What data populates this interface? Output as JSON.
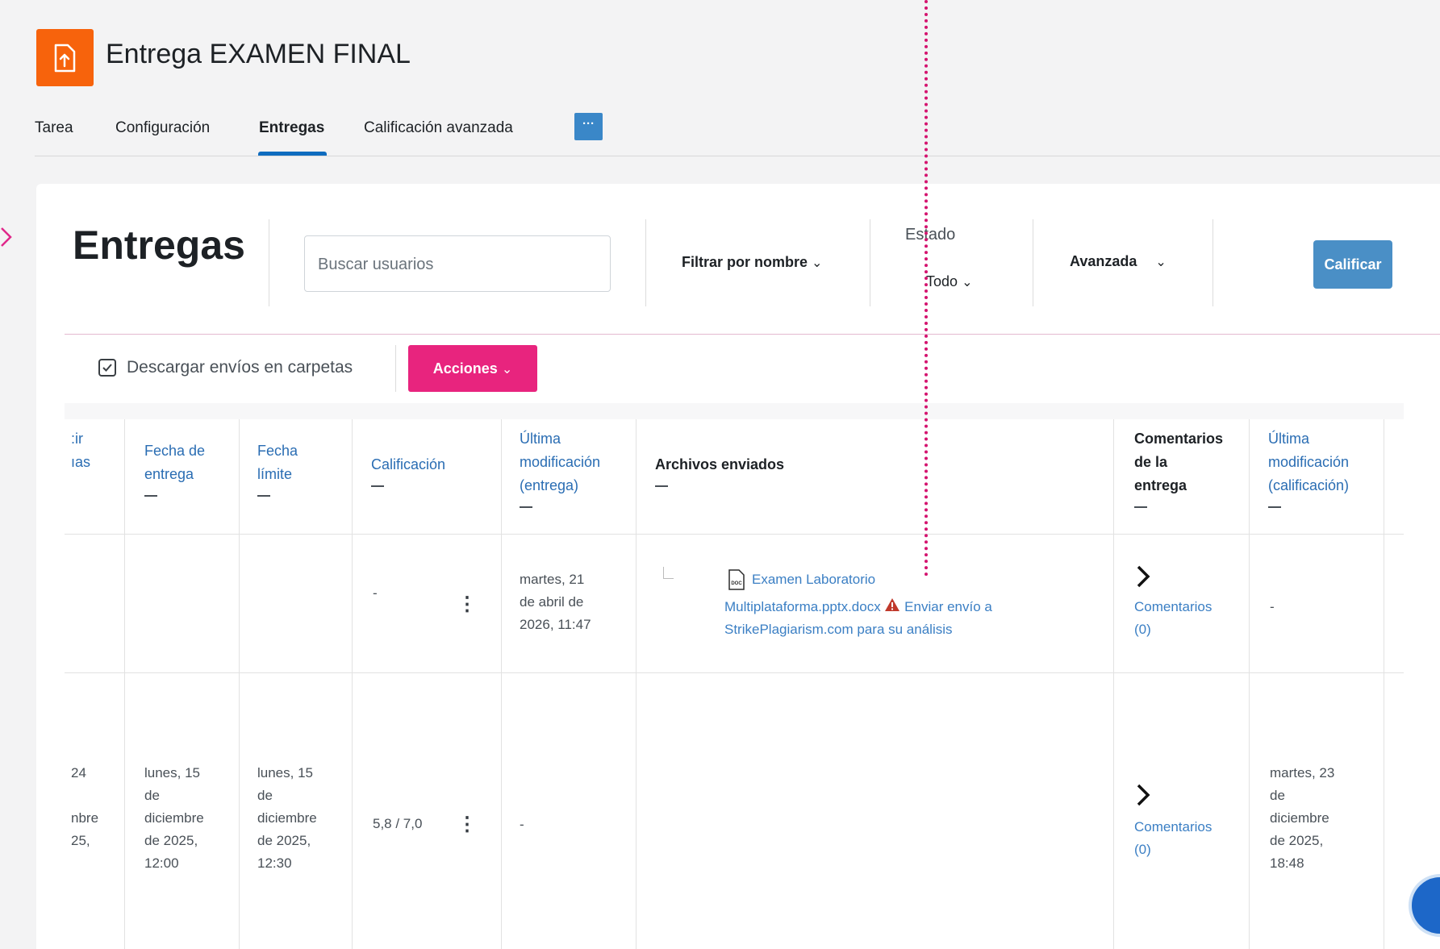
{
  "page": {
    "title": "Entrega EXAMEN FINAL",
    "tabs": [
      "Tarea",
      "Configuración",
      "Entregas",
      "Calificación avanzada"
    ],
    "more_label": "···"
  },
  "toolbar": {
    "heading": "Entregas",
    "search_placeholder": "Buscar usuarios",
    "filter_name": "Filtrar por nombre",
    "estado_label": "Estado",
    "estado_value": "Todo",
    "avanzada": "Avanzada",
    "calificar": "Calificar",
    "chevron": "⌄"
  },
  "actions": {
    "descargar": "Descargar envíos en carpetas",
    "acciones": "Acciones"
  },
  "table": {
    "headers": {
      "col0_l1": ":ir",
      "col0_l2": "ıas",
      "fecha_entrega": [
        "Fecha de",
        "entrega"
      ],
      "fecha_limite": [
        "Fecha",
        "límite"
      ],
      "calificacion": [
        "Calificación"
      ],
      "ultima_mod_entrega": [
        "Última",
        "modificación",
        "(entrega)"
      ],
      "archivos": [
        "Archivos enviados"
      ],
      "comentarios": [
        "Comentarios",
        "de la",
        "entrega"
      ],
      "ultima_mod_calif": [
        "Última",
        "modificación",
        "(calificación)"
      ]
    },
    "row1": {
      "calificacion": "-",
      "ultima_mod": [
        "martes, 21",
        "de abril de",
        "2026, 11:47"
      ],
      "file_name_1": "Examen Laboratorio",
      "file_name_2": "Multiplataforma.pptx.docx",
      "send_1": "Enviar envío a",
      "send_2": "StrikePlagiarism.com para su análisis",
      "comentarios": [
        "Comentarios",
        "(0)"
      ],
      "ultima_calif": "-"
    },
    "row2": {
      "col0": [
        "24",
        "",
        "nbre",
        "25,"
      ],
      "fecha_entrega": [
        "lunes, 15",
        "de",
        "diciembre",
        "de 2025,",
        "12:00"
      ],
      "fecha_limite": [
        "lunes, 15",
        "de",
        "diciembre",
        "de 2025,",
        "12:30"
      ],
      "calificacion": "5,8 / 7,0",
      "ultima_mod": "-",
      "comentarios": [
        "Comentarios",
        "(0)"
      ],
      "ultima_calif": [
        "martes, 23",
        "de",
        "diciembre",
        "de 2025,",
        "18:48"
      ]
    }
  },
  "colors": {
    "accent_orange": "#f7630c",
    "accent_pink": "#e8247e",
    "button_blue": "#4a8fc6",
    "link_blue": "#3b7fc4",
    "annotation_pink": "#d4146f"
  },
  "icons": {
    "assignment": "upload-file-icon",
    "doc": "docx-file-icon",
    "warning": "warning-triangle-icon",
    "expand": "chevron-right-icon"
  }
}
